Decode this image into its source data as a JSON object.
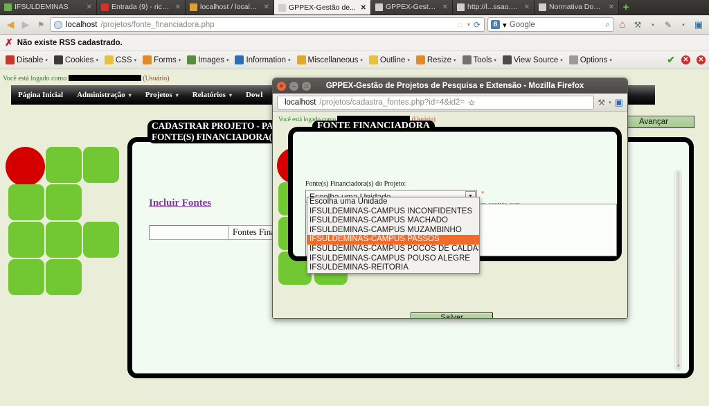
{
  "browser": {
    "tabs": [
      {
        "label": "IFSULDEMINAS",
        "favicon": "#6ab04c",
        "active": false
      },
      {
        "label": "Entrada (9) - ricar...",
        "favicon": "#d93025",
        "active": false
      },
      {
        "label": "localhost / localh...",
        "favicon": "#e0a030",
        "active": false
      },
      {
        "label": "GPPEX-Gestão de...",
        "favicon": "#cfcfcf",
        "active": true
      },
      {
        "label": "GPPEX-Gestão de...",
        "favicon": "#cfcfcf",
        "active": false
      },
      {
        "label": "http://l...ssao.php",
        "favicon": "#cfcfcf",
        "active": false
      },
      {
        "label": "Normativa Docen...",
        "favicon": "#cfcfcf",
        "active": false
      }
    ],
    "new_tab_label": "+",
    "back_label": "◀",
    "forward_label": "▶",
    "url_host": "localhost",
    "url_path": "/projetos/fonte_financiadora.php",
    "star_label": "☆",
    "reload_label": "⟳",
    "search_engine": "8",
    "search_placeholder": "Google",
    "search_magnifier": "⌕",
    "home_label": "⌂",
    "toolbar_extra_icons": [
      "wrench-icon",
      "pencil-icon",
      "panel-icon"
    ]
  },
  "rssbar": {
    "x_mark": "✗",
    "message": "Não existe RSS cadastrado."
  },
  "devbar": {
    "items": [
      {
        "label": "Disable",
        "color": "#c0392b",
        "icon": "disable-icon"
      },
      {
        "label": "Cookies",
        "color": "#3a3a3a",
        "icon": "cookies-icon"
      },
      {
        "label": "CSS",
        "color": "#e8c040",
        "icon": "css-icon"
      },
      {
        "label": "Forms",
        "color": "#e08a2e",
        "icon": "forms-icon"
      },
      {
        "label": "Images",
        "color": "#5a8a40",
        "icon": "images-icon"
      },
      {
        "label": "Information",
        "color": "#2a6fb5",
        "icon": "information-icon"
      },
      {
        "label": "Miscellaneous",
        "color": "#e0a830",
        "icon": "miscellaneous-icon"
      },
      {
        "label": "Outline",
        "color": "#e8c040",
        "icon": "outline-icon"
      },
      {
        "label": "Resize",
        "color": "#e08a2e",
        "icon": "resize-icon"
      },
      {
        "label": "Tools",
        "color": "#707070",
        "icon": "tools-icon"
      },
      {
        "label": "View Source",
        "color": "#4a4a4a",
        "icon": "view-source-icon"
      },
      {
        "label": "Options",
        "color": "#9a9a9a",
        "icon": "options-icon"
      }
    ],
    "caret": "▾",
    "check_label": "✔",
    "error1_label": "✕",
    "error2_label": "✕"
  },
  "page": {
    "logged_prefix": "Você está logado como",
    "logged_suffix": "(Usuário)",
    "nav": [
      {
        "label": "Página Inicial",
        "caret": ""
      },
      {
        "label": "Administração",
        "caret": "▾"
      },
      {
        "label": "Projetos",
        "caret": "▾"
      },
      {
        "label": "Relatórios",
        "caret": "▾"
      },
      {
        "label": "Dowl",
        "caret": ""
      }
    ],
    "content_title": "CADASTRAR PROJETO - PASSO\nFONTE(S) FINANCIADORA(S)",
    "incluir_fontes": "Incluir Fontes",
    "field_value": "",
    "field_label": "Fontes Fina",
    "avancar_label": "Avançar",
    "scroll_up": "▲",
    "scroll_down": "▼"
  },
  "dialog": {
    "window_title": "GPPEX-Gestão de Projetos de Pesquisa e Extensão - Mozilla Firefox",
    "close_label": "✕",
    "minimize_label": "–",
    "maximize_label": "□",
    "url_host": "localhost",
    "url_path": "/projetos/cadastra_fontes.php?id=4&id2=",
    "star_label": "☆",
    "logged_prefix": "Você está logado como",
    "logged_suffix": "(Usuário)",
    "frame_title": "FONTE FINANCIADORA",
    "select_label": "Fonte(s) Financiadora(s) do Projeto:",
    "select_value": "Escolha uma Unidade",
    "select_arrow": "▼",
    "required_mark": "*",
    "hint_text": "m contato com",
    "salvar_label": "Salvar"
  },
  "dropdown": {
    "options": [
      "Escolha uma Unidade",
      "IFSULDEMINAS-CAMPUS INCONFIDENTES",
      "IFSULDEMINAS-CAMPUS MACHADO",
      "IFSULDEMINAS-CAMPUS MUZAMBINHO",
      "IFSULDEMINAS-CAMPUS PASSOS",
      "IFSULDEMINAS-CAMPUS POCOS DE CALDAS",
      "IFSULDEMINAS-CAMPUS POUSO ALEGRE",
      "IFSULDEMINAS-REITORIA"
    ],
    "selected_index": 4,
    "highlight_color": "#f2692c"
  },
  "colors": {
    "page_bg": "#eaeed8",
    "content_bg": "#f2fbf1",
    "logo_green": "#72c832",
    "logo_red": "#d40000",
    "accent_purple": "#7d3c98"
  }
}
